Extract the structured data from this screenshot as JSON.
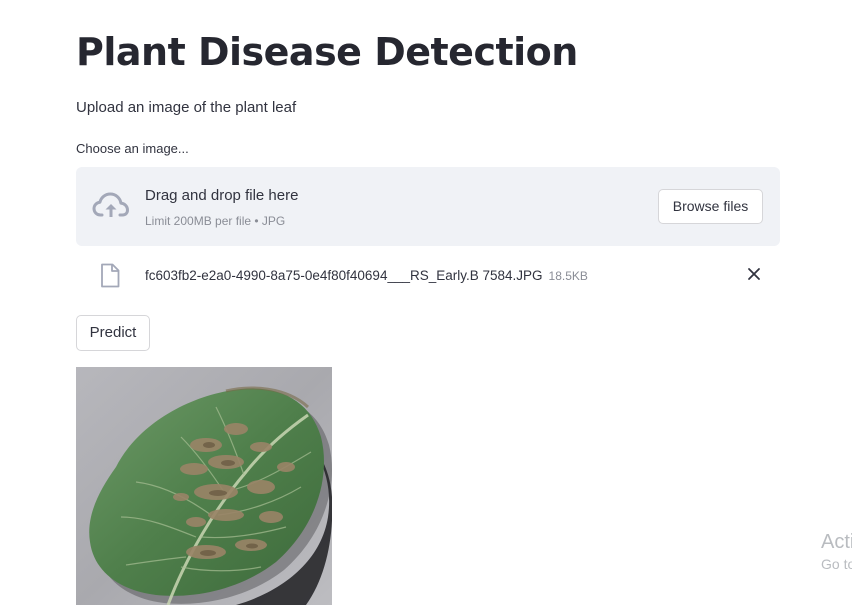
{
  "app": {
    "title": "Plant Disease Detection",
    "subtitle": "Upload an image of the plant leaf"
  },
  "uploader": {
    "label": "Choose an image...",
    "dropzone_text": "Drag and drop file here",
    "limit_text": "Limit 200MB per file • JPG",
    "browse_label": "Browse files",
    "icon": "cloud-upload-icon"
  },
  "uploaded_file": {
    "name": "fc603fb2-e2a0-4990-8a75-0e4f80f40694___RS_Early.B 7584.JPG",
    "size": "18.5KB",
    "icon": "file-icon",
    "remove_icon": "close-icon"
  },
  "actions": {
    "predict_label": "Predict"
  },
  "watermark": {
    "line1": "Acti",
    "line2": "Go to"
  },
  "colors": {
    "dropzone_bg": "#f0f2f6",
    "text": "#31333f",
    "muted": "#8a8d96",
    "border": "#d6d6d9"
  }
}
